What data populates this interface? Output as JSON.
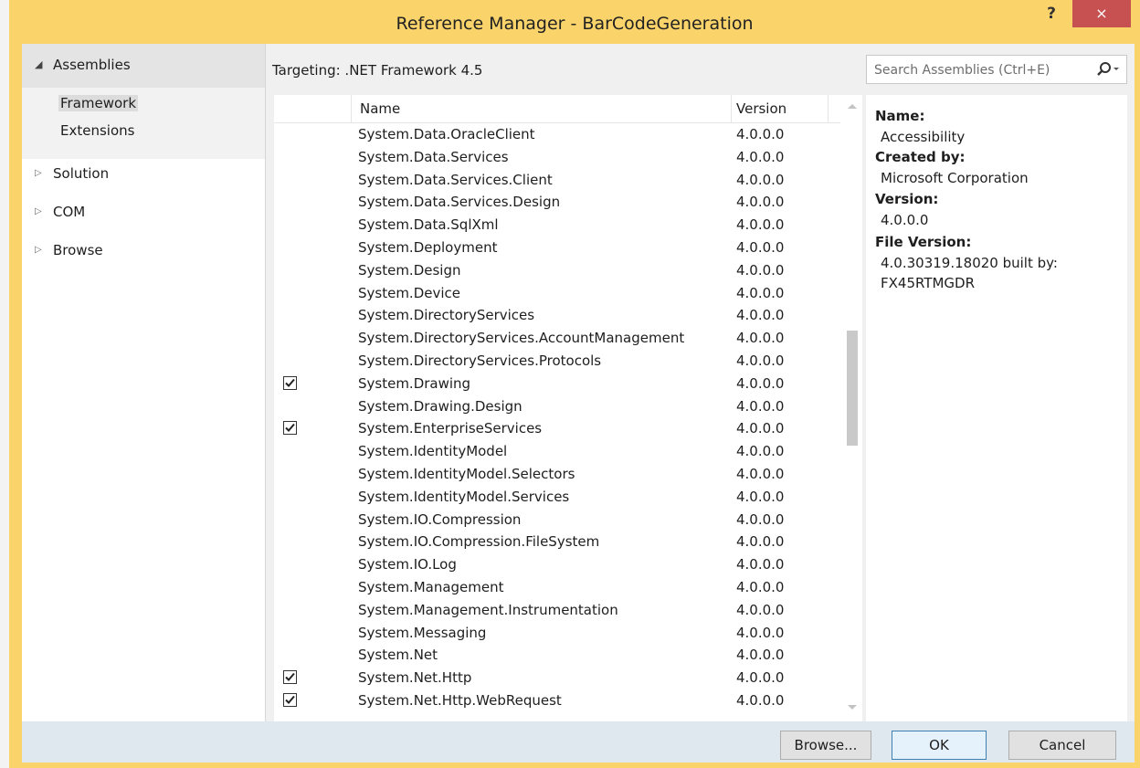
{
  "window": {
    "title": "Reference Manager - BarCodeGeneration",
    "help_label": "?",
    "close_label": "×"
  },
  "nav": {
    "assemblies_label": "Assemblies",
    "sub_items": [
      "Framework",
      "Extensions"
    ],
    "items": [
      "Solution",
      "COM",
      "Browse"
    ]
  },
  "targeting_text": "Targeting: .NET Framework 4.5",
  "search": {
    "placeholder": "Search Assemblies (Ctrl+E)",
    "icon": "search-icon"
  },
  "grid": {
    "columns": {
      "name": "Name",
      "version": "Version"
    },
    "rows": [
      {
        "name": "System.Data.OracleClient",
        "version": "4.0.0.0",
        "checked": false
      },
      {
        "name": "System.Data.Services",
        "version": "4.0.0.0",
        "checked": false
      },
      {
        "name": "System.Data.Services.Client",
        "version": "4.0.0.0",
        "checked": false
      },
      {
        "name": "System.Data.Services.Design",
        "version": "4.0.0.0",
        "checked": false
      },
      {
        "name": "System.Data.SqlXml",
        "version": "4.0.0.0",
        "checked": false
      },
      {
        "name": "System.Deployment",
        "version": "4.0.0.0",
        "checked": false
      },
      {
        "name": "System.Design",
        "version": "4.0.0.0",
        "checked": false
      },
      {
        "name": "System.Device",
        "version": "4.0.0.0",
        "checked": false
      },
      {
        "name": "System.DirectoryServices",
        "version": "4.0.0.0",
        "checked": false
      },
      {
        "name": "System.DirectoryServices.AccountManagement",
        "version": "4.0.0.0",
        "checked": false
      },
      {
        "name": "System.DirectoryServices.Protocols",
        "version": "4.0.0.0",
        "checked": false
      },
      {
        "name": "System.Drawing",
        "version": "4.0.0.0",
        "checked": true
      },
      {
        "name": "System.Drawing.Design",
        "version": "4.0.0.0",
        "checked": false
      },
      {
        "name": "System.EnterpriseServices",
        "version": "4.0.0.0",
        "checked": true
      },
      {
        "name": "System.IdentityModel",
        "version": "4.0.0.0",
        "checked": false
      },
      {
        "name": "System.IdentityModel.Selectors",
        "version": "4.0.0.0",
        "checked": false
      },
      {
        "name": "System.IdentityModel.Services",
        "version": "4.0.0.0",
        "checked": false
      },
      {
        "name": "System.IO.Compression",
        "version": "4.0.0.0",
        "checked": false
      },
      {
        "name": "System.IO.Compression.FileSystem",
        "version": "4.0.0.0",
        "checked": false
      },
      {
        "name": "System.IO.Log",
        "version": "4.0.0.0",
        "checked": false
      },
      {
        "name": "System.Management",
        "version": "4.0.0.0",
        "checked": false
      },
      {
        "name": "System.Management.Instrumentation",
        "version": "4.0.0.0",
        "checked": false
      },
      {
        "name": "System.Messaging",
        "version": "4.0.0.0",
        "checked": false
      },
      {
        "name": "System.Net",
        "version": "4.0.0.0",
        "checked": false
      },
      {
        "name": "System.Net.Http",
        "version": "4.0.0.0",
        "checked": true
      },
      {
        "name": "System.Net.Http.WebRequest",
        "version": "4.0.0.0",
        "checked": true
      }
    ]
  },
  "details": {
    "name_key": "Name:",
    "name_val": "Accessibility",
    "created_key": "Created by:",
    "created_val": "Microsoft Corporation",
    "version_key": "Version:",
    "version_val": "4.0.0.0",
    "filever_key": "File Version:",
    "filever_val1": "4.0.30319.18020 built by:",
    "filever_val2": "FX45RTMGDR"
  },
  "buttons": {
    "browse": "Browse...",
    "ok": "OK",
    "cancel": "Cancel"
  },
  "colors": {
    "title_bar": "#fad46b",
    "close": "#c75050",
    "footer": "#dfe7ef"
  }
}
